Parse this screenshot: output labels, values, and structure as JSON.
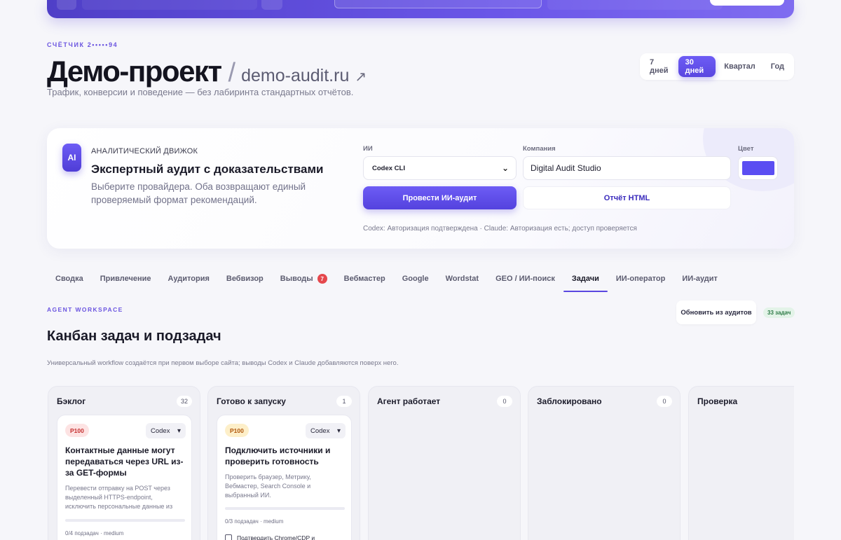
{
  "header": {
    "kicker": "СЧЁТЧИК 2•••••94",
    "project_name": "Демо-проект",
    "slash": "/",
    "domain": "demo-audit.ru",
    "external_icon": "↗",
    "subtitle": "Трафик, конверсии и поведение — без лабиринта стандартных отчётов."
  },
  "period": {
    "items": [
      "7 дней",
      "30 дней",
      "Квартал",
      "Год"
    ],
    "active": "30 дней"
  },
  "ai_panel": {
    "badge": "AI",
    "label": "АНАЛИТИЧЕСКИЙ ДВИЖОК",
    "title": "Экспертный аудит с доказательствами",
    "description": "Выберите провайдера. Оба возвращают единый проверяемый формат рекомендаций.",
    "provider_label": "ИИ",
    "provider_value": "Codex CLI",
    "company_label": "Компания",
    "company_value": "Digital Audit Studio",
    "color_label": "Цвет",
    "color_value": "#5b4ef2",
    "run_button": "Провести ИИ-аудит",
    "report_button": "Отчёт HTML",
    "status": "Codex: Авторизация подтверждена · Claude: Авторизация есть; доступ проверяется"
  },
  "tabs": [
    {
      "label": "Сводка"
    },
    {
      "label": "Привлечение"
    },
    {
      "label": "Аудитория"
    },
    {
      "label": "Вебвизор"
    },
    {
      "label": "Выводы",
      "count": "7"
    },
    {
      "label": "Вебмастер"
    },
    {
      "label": "Google"
    },
    {
      "label": "Wordstat"
    },
    {
      "label": "GEO / ИИ-поиск"
    },
    {
      "label": "Задачи",
      "active": true
    },
    {
      "label": "ИИ-оператор"
    },
    {
      "label": "ИИ-аудит"
    }
  ],
  "workspace": {
    "kicker": "AGENT WORKSPACE",
    "title": "Канбан задач и подзадач",
    "description": "Универсальный workflow создаётся при первом выборе сайта; выводы Codex и Claude добавляются поверх него.",
    "refresh_button": "Обновить из аудитов",
    "task_count": "33 задач"
  },
  "kanban": {
    "columns": [
      {
        "title": "Бэклог",
        "count": "32",
        "card": {
          "priority": "P100",
          "agent": "Codex",
          "title": "Контактные данные могут передаваться через URL из-за GET-формы",
          "description": "Перевести отправку на POST через выделенный HTTPS-endpoint, исключить персональные данные из",
          "progress": 0,
          "meta": "0/4 подзадач · medium"
        }
      },
      {
        "title": "Готово к запуску",
        "count": "1",
        "card": {
          "priority": "P100",
          "agent": "Codex",
          "title": "Подключить источники и проверить готовность",
          "description": "Проверить браузер, Метрику, Вебмастер, Search Console и выбранный ИИ.",
          "progress": 0,
          "meta": "0/3 подзадач · medium",
          "subtask": "Подтвердить Chrome/CDP и"
        }
      },
      {
        "title": "Агент работает",
        "count": "0"
      },
      {
        "title": "Заблокировано",
        "count": "0"
      },
      {
        "title": "Проверка"
      }
    ]
  }
}
